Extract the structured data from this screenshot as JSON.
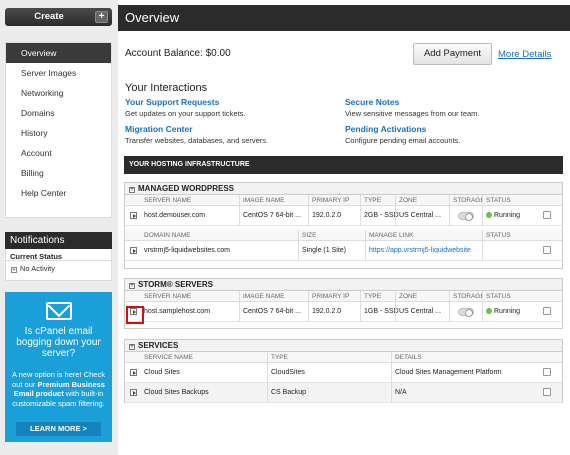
{
  "sidebar": {
    "create_label": "Create",
    "create_plus": "+",
    "nav": [
      "Overview",
      "Server Images",
      "Networking",
      "Domains",
      "History",
      "Account",
      "Billing",
      "Help Center"
    ],
    "active": "Overview",
    "notifications": {
      "title": "Notifications",
      "current_status": "Current Status",
      "activity": "No Activity",
      "activity_icon": "+"
    },
    "ad": {
      "title_line1": "Is cPanel email",
      "title_line2": "bogging down your",
      "title_line3": "server?",
      "body_plain1": "A new option is here! Check out our ",
      "body_bold": "Premium Business Email product",
      "body_plain2": " with built-in customizable spam filtering.",
      "button": "LEARN MORE >",
      "icon": "envelope-icon"
    }
  },
  "main": {
    "title": "Overview",
    "balance": "Account Balance: $0.00",
    "add_payment": "Add Payment",
    "more_details": "More Details",
    "interactions_title": "Your Interactions",
    "interactions": [
      {
        "link": "Your Support Requests",
        "desc": "Get updates on your support tickets."
      },
      {
        "link": "Secure Notes",
        "desc": "View sensitive messages from our team."
      },
      {
        "link": "Migration Center",
        "desc": "Transfer websites, databases, and servers."
      },
      {
        "link": "Pending Activations",
        "desc": "Configure pending email accounts."
      }
    ],
    "infra_title": "YOUR HOSTING INFRASTRUCTURE",
    "wordpress": {
      "title": "MANAGED WORDPRESS",
      "toggle_icon": "+",
      "server_headers": [
        "SERVER NAME",
        "IMAGE NAME",
        "PRIMARY IP",
        "TYPE",
        "ZONE",
        "STORAGE",
        "STATUS"
      ],
      "server": {
        "name": "host.demouser.com",
        "image": "CentOS 7 64-bit ...",
        "ip": "192.0.2.0",
        "type": "2GB - SSD",
        "zone": "US Central ...",
        "status": "Running"
      },
      "domain_headers": [
        "DOMAIN NAME",
        "SIZE",
        "MANAGE LINK",
        "STATUS"
      ],
      "domain": {
        "name": "vrstrmj5-liquidwebsites.com",
        "size": "Single (1 Site)",
        "link": "https://app.vrstrmj5-liquidwebsite"
      }
    },
    "storm": {
      "title": "STORM® SERVERS",
      "toggle_icon": "+",
      "headers": [
        "SERVER NAME",
        "IMAGE NAME",
        "PRIMARY IP",
        "TYPE",
        "ZONE",
        "STORAGE",
        "STATUS"
      ],
      "server": {
        "name": "host.samplehost.com",
        "image": "CentOS 7 64-bit ...",
        "ip": "192.0.2.0",
        "type": "1GB - SSD",
        "zone": "US Central ...",
        "status": "Running"
      }
    },
    "services": {
      "title": "SERVICES",
      "toggle_icon": "+",
      "headers": [
        "SERVICE NAME",
        "TYPE",
        "DETAILS"
      ],
      "rows": [
        {
          "name": "Cloud Sites",
          "type": "CloudSites",
          "details": "Cloud Sites Management Platform"
        },
        {
          "name": "Cloud Sites Backups",
          "type": "CS Backup",
          "details": "N/A"
        }
      ]
    }
  }
}
